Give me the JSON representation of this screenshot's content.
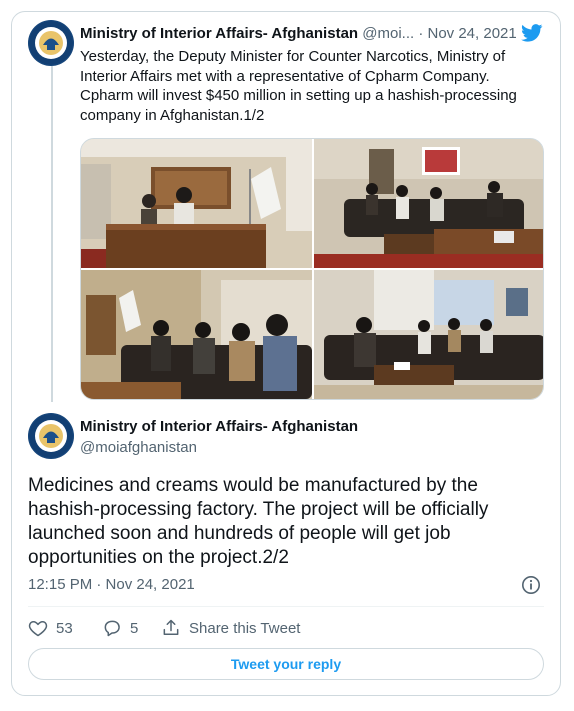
{
  "parent_tweet": {
    "author_name": "Ministry of Interior Affairs- Afghanistan",
    "handle": "@moi...",
    "separator": "·",
    "date": "Nov 24, 2021",
    "text": "Yesterday, the Deputy Minister for Counter Narcotics, Ministry of Interior Affairs met with a representative of Cpharm Company. Cpharm will invest $450 million in setting up a hashish-processing company in Afghanistan.1/2",
    "photo_count": 4
  },
  "main_tweet": {
    "author_name": "Ministry of Interior Affairs- Afghanistan",
    "handle": "@moiafghanistan",
    "text": "Medicines and creams would be manufactured by the hashish-processing factory. The project will be officially launched soon and hundreds of people will get job opportunities on the project.2/2",
    "timestamp": "12:15 PM · Nov 24, 2021"
  },
  "actions": {
    "like_count": "53",
    "reply_count": "5",
    "share_label": "Share this Tweet"
  },
  "reply_button_label": "Tweet your reply",
  "icons": [
    "twitter-bird-icon",
    "info-icon",
    "heart-icon",
    "reply-icon",
    "share-icon"
  ],
  "colors": {
    "accent": "#1d9bf0",
    "secondary_text": "#536471",
    "border": "#cfd9de"
  }
}
